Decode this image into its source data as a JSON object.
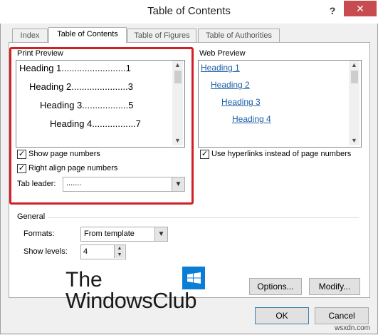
{
  "window": {
    "title": "Table of Contents",
    "help_glyph": "?",
    "close_glyph": "✕"
  },
  "tabs": [
    {
      "label": "Index"
    },
    {
      "label": "Table of Contents"
    },
    {
      "label": "Table of Figures"
    },
    {
      "label": "Table of Authorities"
    }
  ],
  "print_preview": {
    "label": "Print Preview",
    "lines": [
      {
        "text": "Heading 1.........................1"
      },
      {
        "text": "Heading 2......................3"
      },
      {
        "text": "Heading 3..................5"
      },
      {
        "text": "Heading 4.................7"
      }
    ],
    "show_page_numbers": {
      "label": "Show page numbers",
      "checked": true
    },
    "right_align": {
      "label": "Right align page numbers",
      "checked": true
    },
    "tab_leader": {
      "label": "Tab leader:",
      "value": "......."
    }
  },
  "web_preview": {
    "label": "Web Preview",
    "links": [
      "Heading 1",
      "Heading 2",
      "Heading 3",
      "Heading 4"
    ],
    "use_hyperlinks": {
      "label": "Use hyperlinks instead of page numbers",
      "checked": true
    }
  },
  "general": {
    "label": "General",
    "formats": {
      "label": "Formats:",
      "value": "From template"
    },
    "show_levels": {
      "label": "Show levels:",
      "value": "4"
    }
  },
  "buttons": {
    "options": "Options...",
    "modify": "Modify...",
    "ok": "OK",
    "cancel": "Cancel"
  },
  "watermark": {
    "line1": "The",
    "line2": "WindowsClub",
    "site": "wsxdn.com"
  },
  "colors": {
    "highlight": "#d02027",
    "link": "#1c5fa8",
    "close": "#c74b50"
  }
}
